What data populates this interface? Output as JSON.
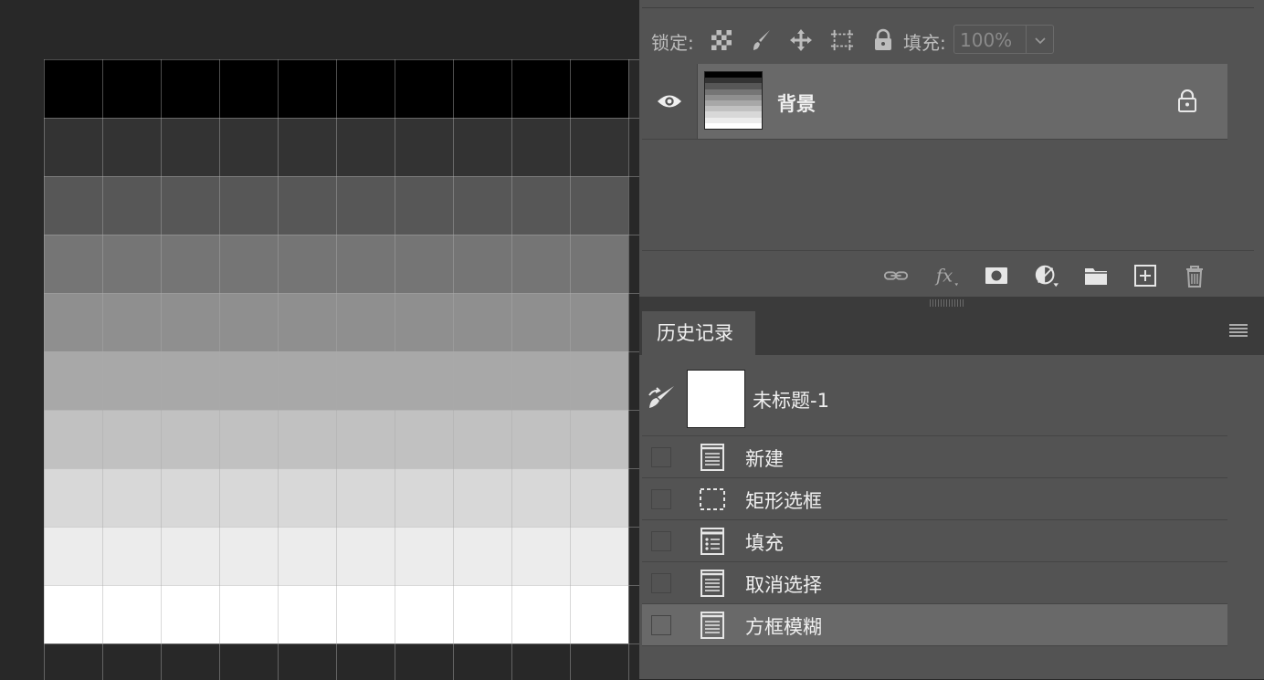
{
  "canvas": {
    "band_colors": [
      "#000000",
      "#333333",
      "#575757",
      "#757575",
      "#8f8f8f",
      "#a8a8a8",
      "#c1c1c1",
      "#d8d8d8",
      "#ececec",
      "#ffffff"
    ]
  },
  "layers": {
    "lock_label": "锁定:",
    "fill_label": "填充:",
    "fill_value": "100%",
    "layer_name": "背景"
  },
  "history": {
    "tab_label": "历史记录",
    "snapshot_name": "未标题-1",
    "items": [
      {
        "label": "新建",
        "icon": "document-icon"
      },
      {
        "label": "矩形选框",
        "icon": "marquee-icon"
      },
      {
        "label": "填充",
        "icon": "fill-list-icon"
      },
      {
        "label": "取消选择",
        "icon": "document-icon"
      },
      {
        "label": "方框模糊",
        "icon": "document-icon"
      }
    ],
    "active_index": 4
  }
}
